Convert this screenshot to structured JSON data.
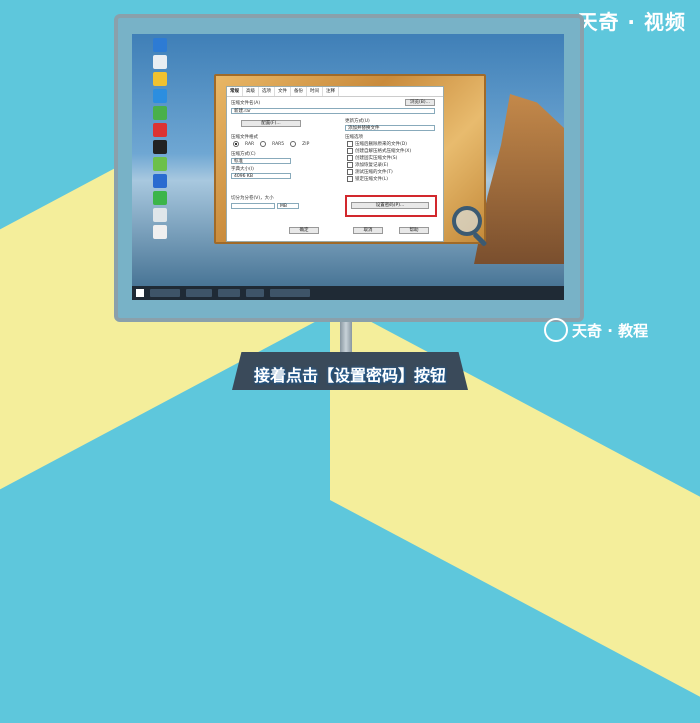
{
  "brand": {
    "top_right": "天奇 · 视频",
    "bottom_right": "天奇 · 教程"
  },
  "caption": "接着点击【设置密码】按钮",
  "colors": {
    "background": "#5ec7dc",
    "accent_yellow": "#f4ee9b",
    "highlight": "#d2282d"
  },
  "dialog": {
    "tabs": [
      "常规",
      "高级",
      "选项",
      "文件",
      "备份",
      "时间",
      "注释"
    ],
    "archive_name_label": "压缩文件名(A)",
    "browse_button": "浏览(B)...",
    "archive_name_value": "新建.rar",
    "profile_button": "配置(F)...",
    "update_mode_label": "更新方式(U)",
    "update_mode_value": "添加并替换文件",
    "format_label": "压缩文件格式",
    "format_options": [
      "RAR",
      "RAR5",
      "ZIP"
    ],
    "method_label": "压缩方式(C)",
    "method_value": "标准",
    "dict_label": "字典大小(I)",
    "dict_value": "4096 KB",
    "split_label": "切分为分卷(V)，大小",
    "split_unit": "MB",
    "options_label": "压缩选项",
    "options": [
      "压缩后删除原来的文件(D)",
      "创建自解压格式压缩文件(X)",
      "创建固实压缩文件(S)",
      "添加恢复记录(E)",
      "测试压缩的文件(T)",
      "锁定压缩文件(L)"
    ],
    "set_password_button": "设置密码(P)...",
    "ok_button": "确定",
    "cancel_button": "取消",
    "help_button": "帮助"
  },
  "icons": [
    "arrow-up-icon",
    "magnifier-icon"
  ]
}
